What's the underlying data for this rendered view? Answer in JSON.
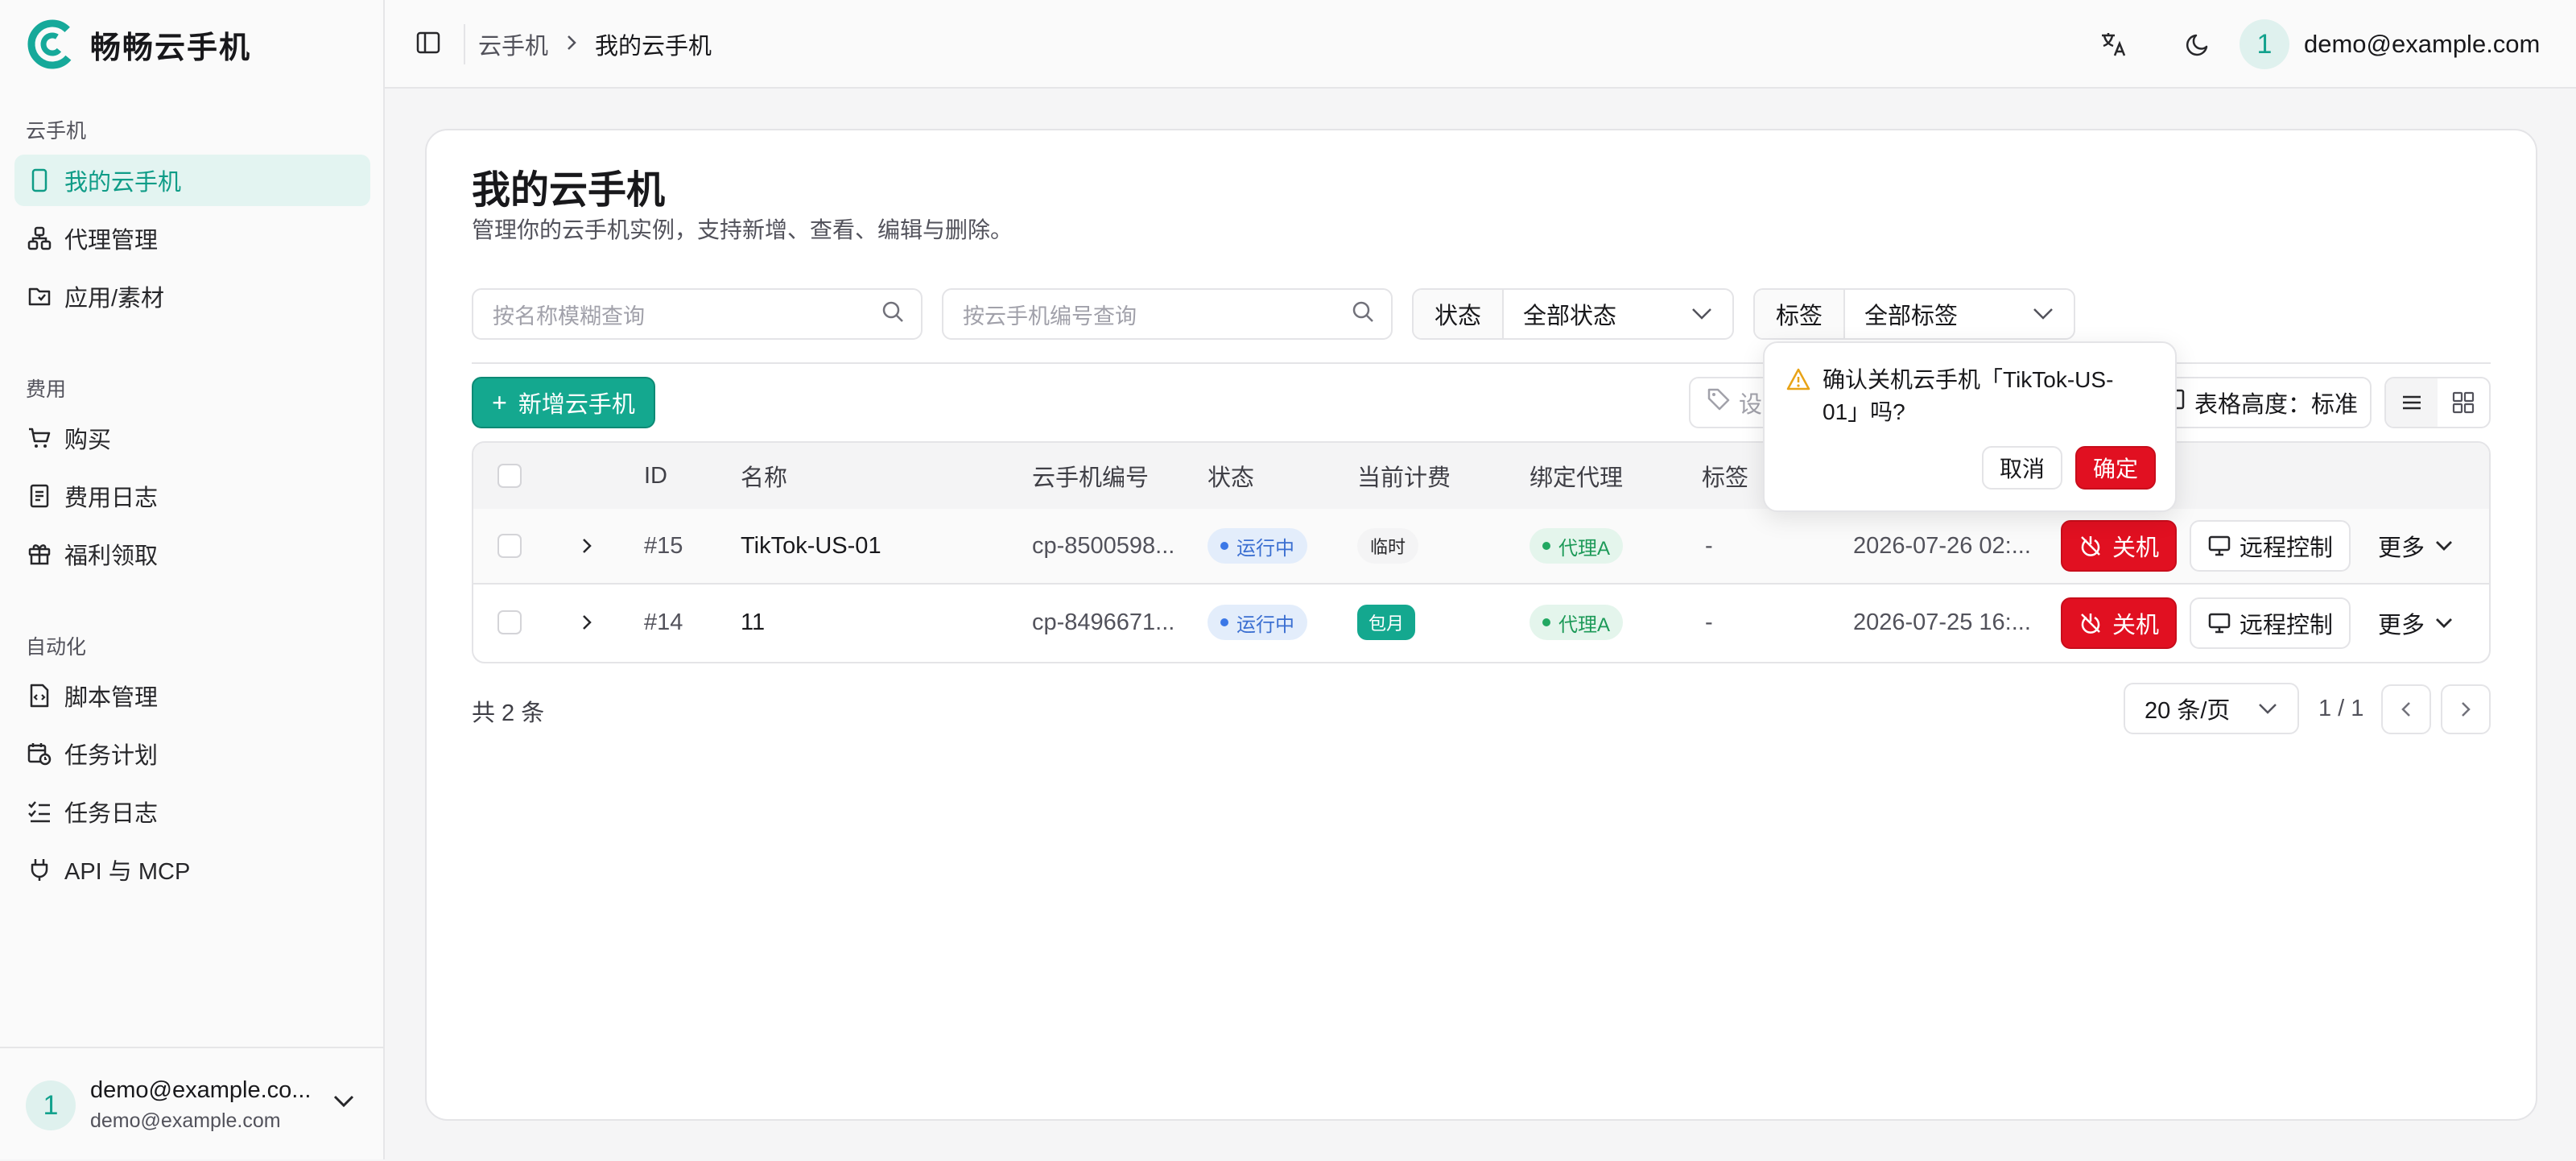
{
  "app": {
    "name": "畅畅云手机"
  },
  "sidebar": {
    "groups": [
      {
        "title": "云手机",
        "items": [
          {
            "label": "我的云手机",
            "active": true
          },
          {
            "label": "代理管理"
          },
          {
            "label": "应用/素材"
          }
        ]
      },
      {
        "title": "费用",
        "items": [
          {
            "label": "购买"
          },
          {
            "label": "费用日志"
          },
          {
            "label": "福利领取"
          }
        ]
      },
      {
        "title": "自动化",
        "items": [
          {
            "label": "脚本管理"
          },
          {
            "label": "任务计划"
          },
          {
            "label": "任务日志"
          },
          {
            "label": "API 与 MCP"
          }
        ]
      }
    ],
    "user": {
      "avatar": "1",
      "name": "demo@example.co...",
      "email": "demo@example.com"
    }
  },
  "topbar": {
    "breadcrumb": [
      "云手机",
      "我的云手机"
    ],
    "user_avatar": "1",
    "user_email": "demo@example.com"
  },
  "page": {
    "title": "我的云手机",
    "subtitle": "管理你的云手机实例，支持新增、查看、编辑与删除。"
  },
  "filters": {
    "name_placeholder": "按名称模糊查询",
    "serial_placeholder": "按云手机编号查询",
    "status_label": "状态",
    "status_value": "全部状态",
    "tag_label": "标签",
    "tag_value": "全部标签"
  },
  "toolbar": {
    "add_label": "新增云手机",
    "tag_button_partial": "设",
    "table_height_label": "表格高度：标准"
  },
  "table": {
    "headers": [
      "ID",
      "名称",
      "云手机编号",
      "状态",
      "当前计费",
      "绑定代理",
      "标签"
    ],
    "rows": [
      {
        "id": "#15",
        "name": "TikTok-US-01",
        "serial": "cp-8500598...",
        "status": "运行中",
        "billing": "临时",
        "proxy": "代理A",
        "tag": "-",
        "time": "2026-07-26 02:...",
        "power": "关机",
        "remote": "远程控制",
        "more": "更多"
      },
      {
        "id": "#14",
        "name": "11",
        "serial": "cp-8496671...",
        "status": "运行中",
        "billing": "包月",
        "proxy": "代理A",
        "tag": "-",
        "time": "2026-07-25 16:...",
        "power": "关机",
        "remote": "远程控制",
        "more": "更多"
      }
    ]
  },
  "pagination": {
    "total": "共 2 条",
    "page_size": "20 条/页",
    "page": "1 / 1"
  },
  "popover": {
    "message": "确认关机云手机「TikTok-US-01」吗?",
    "cancel": "取消",
    "confirm": "确定"
  },
  "colors": {
    "accent": "#14a88f",
    "danger": "#e11021",
    "running": "#3b78e7"
  }
}
